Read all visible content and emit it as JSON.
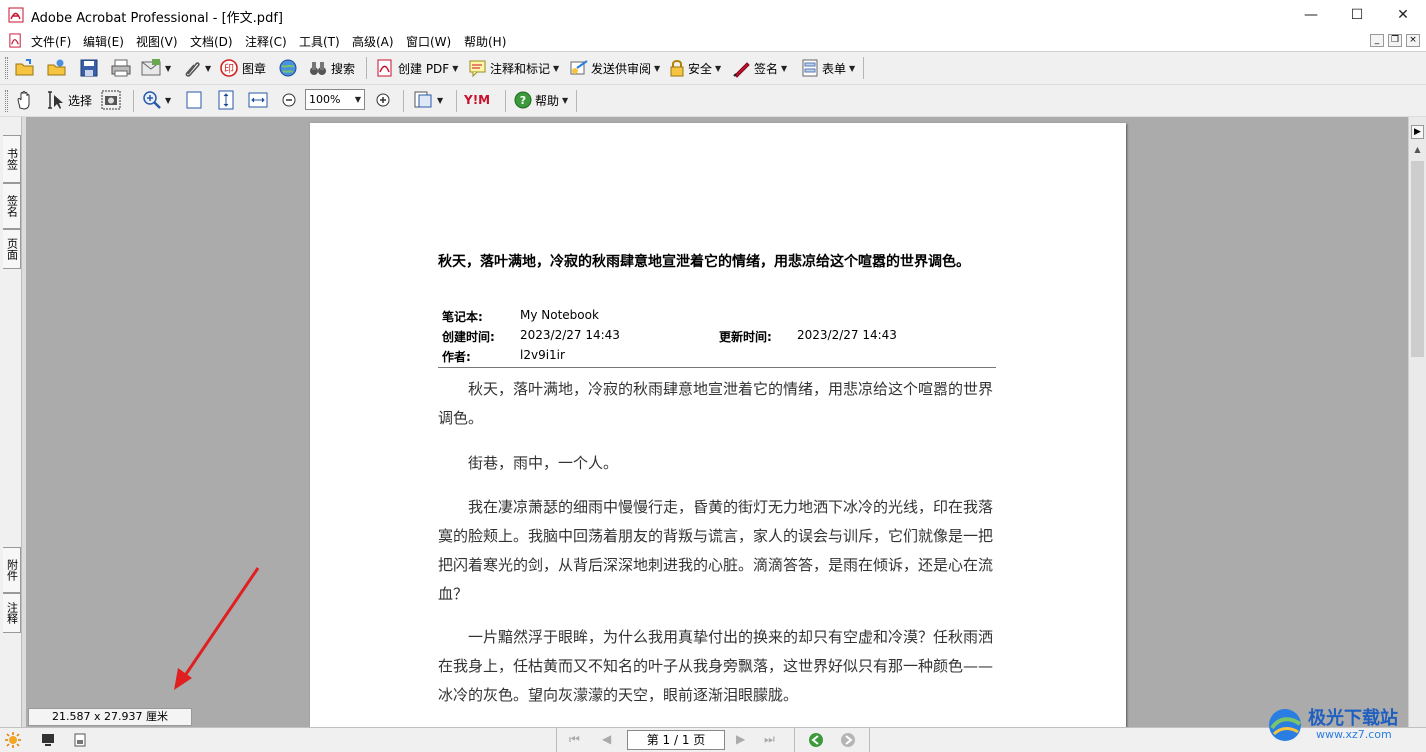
{
  "window": {
    "title": "Adobe Acrobat Professional - [作文.pdf]",
    "minimize": "—",
    "maximize": "☐",
    "close": "✕"
  },
  "menu": [
    "文件(F)",
    "编辑(E)",
    "视图(V)",
    "文档(D)",
    "注释(C)",
    "工具(T)",
    "高级(A)",
    "窗口(W)",
    "帮助(H)"
  ],
  "toolbar1": {
    "stamp": "图章",
    "search": "搜索",
    "create_pdf": "创建 PDF",
    "comment_markup": "注释和标记",
    "send_review": "发送供审阅",
    "security": "安全",
    "sign": "签名",
    "forms": "表单"
  },
  "toolbar2": {
    "select": "选择",
    "zoom": "100%",
    "help": "帮助",
    "yim": "Y!M"
  },
  "side_tabs": {
    "bookmarks": "书签",
    "signatures": "签名",
    "pages": "页面",
    "attachments": "附件",
    "comments": "注释"
  },
  "document": {
    "title": "秋天，落叶满地，冷寂的秋雨肆意地宣泄着它的情绪，用悲凉给这个喧嚣的世界调色。",
    "notebook_label": "笔记本:",
    "notebook_value": "My Notebook",
    "created_label": "创建时间:",
    "created_value": "2023/2/27 14:43",
    "updated_label": "更新时间:",
    "updated_value": "2023/2/27 14:43",
    "author_label": "作者:",
    "author_value": "l2v9i1ir",
    "paragraphs": [
      "秋天，落叶满地，冷寂的秋雨肆意地宣泄着它的情绪，用悲凉给这个喧嚣的世界调色。",
      "街巷，雨中，一个人。",
      "我在凄凉萧瑟的细雨中慢慢行走，昏黄的街灯无力地洒下冰冷的光线，印在我落寞的脸颊上。我脑中回荡着朋友的背叛与谎言，家人的误会与训斥，它们就像是一把把闪着寒光的剑，从背后深深地刺进我的心脏。滴滴答答，是雨在倾诉，还是心在流血？",
      "一片黯然浮于眼眸，为什么我用真挚付出的换来的却只有空虚和冷漠？任秋雨洒在我身上，任枯黄而又不知名的叶子从我身旁飘落，这世界好似只有那一种颜色——冰冷的灰色。望向灰濛濛的天空，眼前逐渐泪眼朦胧。"
    ]
  },
  "status": {
    "page_size": "21.587 x 27.937 厘米",
    "page_nav": "第 1 / 1 页"
  },
  "watermark": {
    "name": "极光下载站",
    "url": "www.xz7.com"
  },
  "colors": {
    "arrow": "#e02020",
    "acrobat_red": "#c8102e"
  }
}
